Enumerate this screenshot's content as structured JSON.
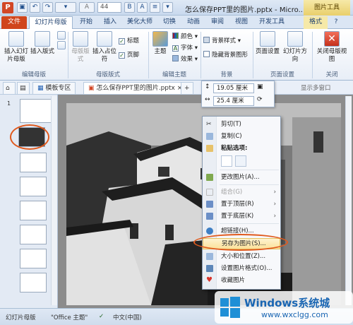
{
  "window": {
    "title": "怎么保存PPT里的图片.pptx - Micro...",
    "font_size_value": "44",
    "tools_header": "图片工具"
  },
  "ribbon_tabs": [
    {
      "label": "文件"
    },
    {
      "label": "幻灯片母版"
    },
    {
      "label": "开始"
    },
    {
      "label": "插入"
    },
    {
      "label": "美化大师"
    },
    {
      "label": "切换"
    },
    {
      "label": "动画"
    },
    {
      "label": "审阅"
    },
    {
      "label": "视图"
    },
    {
      "label": "开发工具"
    },
    {
      "label": "格式"
    }
  ],
  "ribbon": {
    "insert_slide_master": "插入幻灯片母版",
    "insert_layout": "插入版式",
    "master_layout": "母版版式",
    "insert_placeholder": "插入占位符",
    "title_check": "标题",
    "footer_check": "页脚",
    "themes": "主题",
    "colors": "颜色",
    "fonts": "字体",
    "effects": "效果",
    "background_styles": "背景样式",
    "hide_bg_graphics": "隐藏背景图形",
    "page_setup": "页面设置",
    "slide_orientation": "幻灯片方向",
    "close_master_view": "关闭母版视图",
    "groups": {
      "edit_master": "编辑母版",
      "master_layout": "母版版式",
      "edit_theme": "编辑主题",
      "background": "背景",
      "page_setup": "页面设置",
      "close": "关闭"
    }
  },
  "doc_tabs": [
    {
      "label": "模板专区"
    },
    {
      "label": "怎么保存PPT里的图片.pptx"
    },
    {
      "label": "+"
    }
  ],
  "show_multi_window": "显示多窗口",
  "thumbnails": [
    {
      "num": "1"
    },
    {
      "num": ""
    },
    {
      "num": ""
    },
    {
      "num": ""
    },
    {
      "num": ""
    },
    {
      "num": ""
    },
    {
      "num": ""
    },
    {
      "num": ""
    }
  ],
  "float_toolbar": {
    "height_value": "19.05 厘米",
    "width_value": "25.4 厘米"
  },
  "context_menu": {
    "cut": "剪切(T)",
    "copy": "复制(C)",
    "paste_options": "粘贴选项:",
    "change_picture": "更改图片(A)...",
    "group": "组合(G)",
    "bring_to_front": "置于顶层(R)",
    "send_to_back": "置于底层(K)",
    "hyperlink": "超链接(H)...",
    "save_as_picture": "另存为图片(S)...",
    "size_position": "大小和位置(Z)...",
    "format_picture": "设置图片格式(O)...",
    "favorite_picture": "收藏图片"
  },
  "status_bar": {
    "view": "幻灯片母版",
    "theme": "\"Office 主题\"",
    "language": "中文(中国)"
  },
  "watermark": {
    "brand": "Windows系统城",
    "url": "www.wxclgg.com"
  },
  "colors": {
    "accent": "#d0451c",
    "highlight": "#e05a1e",
    "ribbon_blue": "#1d3f6e"
  }
}
